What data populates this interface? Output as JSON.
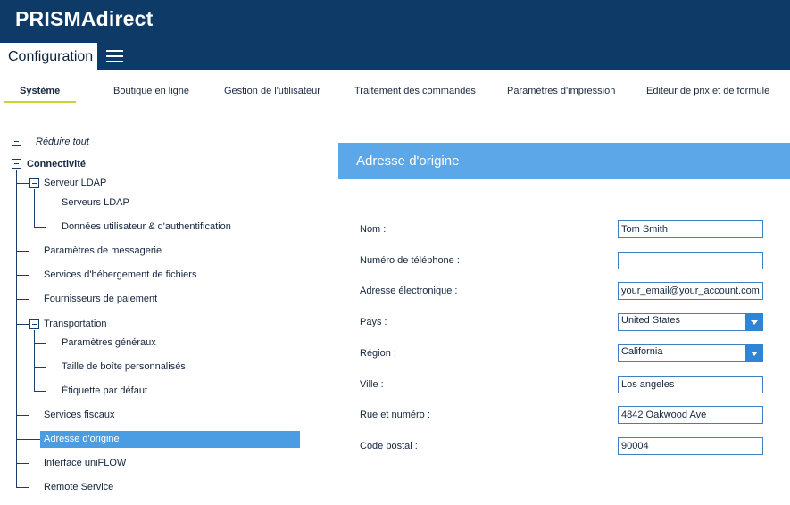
{
  "app": {
    "brand": "PRISMAdirect",
    "section": "Configuration"
  },
  "nav": {
    "tabs": [
      {
        "label": "Système",
        "active": true
      },
      {
        "label": "Boutique en ligne"
      },
      {
        "label": "Gestion de l'utilisateur"
      },
      {
        "label": "Traitement des commandes"
      },
      {
        "label": "Paramètres d'impression"
      },
      {
        "label": "Editeur de prix et de formule"
      }
    ]
  },
  "tree": {
    "collapse_all": "Réduire tout",
    "root": "Connectivité",
    "items": [
      "Serveur LDAP",
      "Serveurs LDAP",
      "Données utilisateur & d'authentification",
      "Paramètres de messagerie",
      "Services d'hébergement de fichiers",
      "Fournisseurs de paiement",
      "Transportation",
      "Paramètres généraux",
      "Taille de boîte personnalisés",
      "Étiquette par défaut",
      "Services fiscaux",
      "Adresse d'origine",
      "Interface uniFLOW",
      "Remote Service"
    ],
    "selected": "Adresse d'origine"
  },
  "panel": {
    "title": "Adresse d'origine",
    "fields": [
      {
        "label": "Nom :",
        "value": "Tom Smith"
      },
      {
        "label": "Numéro de téléphone :",
        "value": ""
      },
      {
        "label": "Adresse électronique :",
        "value": "your_email@your_account.com"
      },
      {
        "label": "Pays :",
        "value": "United States"
      },
      {
        "label": "Région :",
        "value": "California"
      },
      {
        "label": "Ville :",
        "value": "Los angeles"
      },
      {
        "label": "Rue et numéro :",
        "value": "4842 Oakwood Ave"
      },
      {
        "label": "Code postal :",
        "value": "90004"
      }
    ]
  },
  "colors": {
    "header": "#0d3a66",
    "accent": "#5ba7e8",
    "selected": "#4a9de2",
    "underline": "#c9d23a"
  }
}
